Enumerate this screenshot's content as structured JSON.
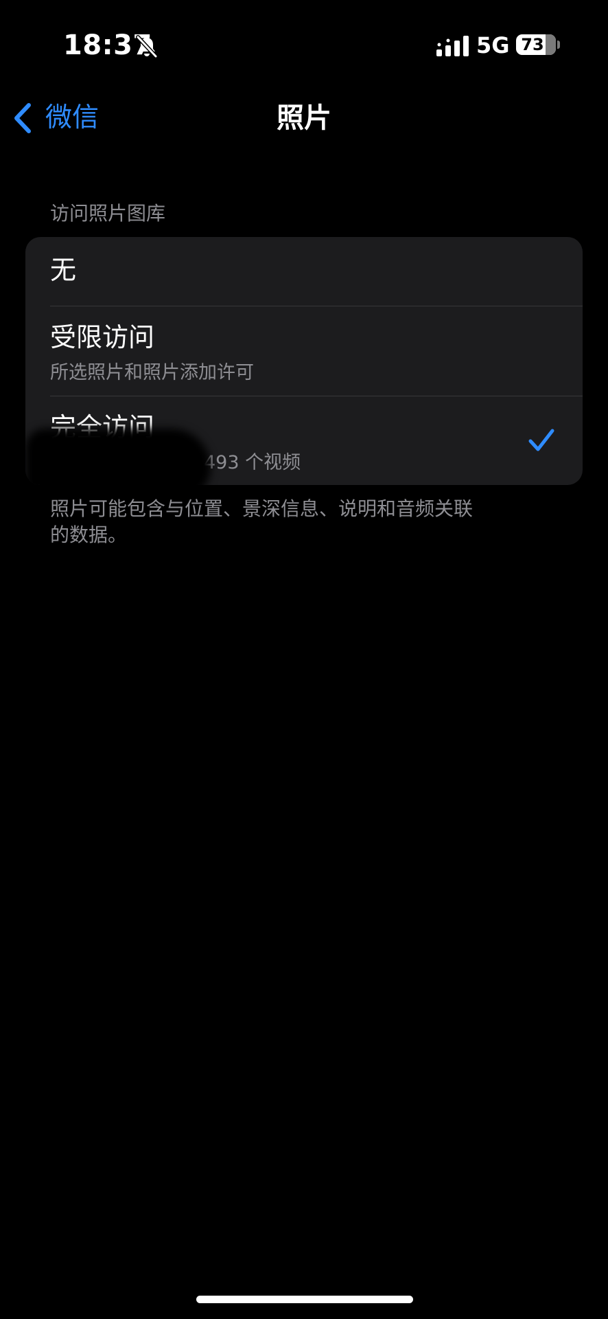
{
  "status_bar": {
    "time": "18:37",
    "network": "5G",
    "battery": "73",
    "battery_level_percent": 73
  },
  "nav": {
    "back_label": "微信",
    "title": "照片"
  },
  "section": {
    "header": "访问照片图库",
    "options": [
      {
        "title": "无",
        "subtitle": ""
      },
      {
        "title": "受限访问",
        "subtitle": "所选照片和照片添加许可"
      },
      {
        "title": "完全访问",
        "subtitle": "493 个视频"
      }
    ],
    "selected_index": 2,
    "footer": "照片可能包含与位置、景深信息、说明和音频关联的数据。"
  },
  "colors": {
    "accent": "#2f8cff",
    "background": "#000000",
    "group_background": "#1c1c1e",
    "secondary_text": "#8e8e93"
  },
  "icons": {
    "back": "chevron-left-icon",
    "silent": "bell-slash-icon",
    "signal": "cellular-signal-icon",
    "selected": "checkmark-icon"
  }
}
